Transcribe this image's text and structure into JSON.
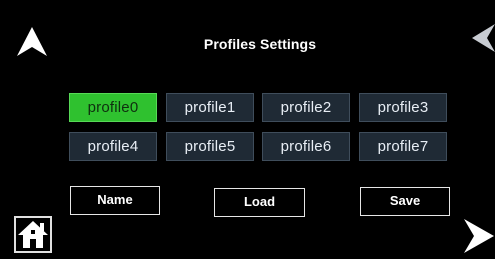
{
  "header": {
    "title": "Profiles Settings"
  },
  "profiles": [
    {
      "label": "profile0",
      "selected": true
    },
    {
      "label": "profile1",
      "selected": false
    },
    {
      "label": "profile2",
      "selected": false
    },
    {
      "label": "profile3",
      "selected": false
    },
    {
      "label": "profile4",
      "selected": false
    },
    {
      "label": "profile5",
      "selected": false
    },
    {
      "label": "profile6",
      "selected": false
    },
    {
      "label": "profile7",
      "selected": false
    }
  ],
  "actions": {
    "name_label": "Name",
    "load_label": "Load",
    "save_label": "Save"
  },
  "icons": {
    "up": "arrow-up-icon",
    "back": "chevron-left-icon",
    "next": "arrow-right-icon",
    "home": "home-icon"
  },
  "colors": {
    "background": "#000000",
    "selected": "#2fc12f",
    "unselected": "#1f2a35",
    "text": "#ffffff"
  }
}
